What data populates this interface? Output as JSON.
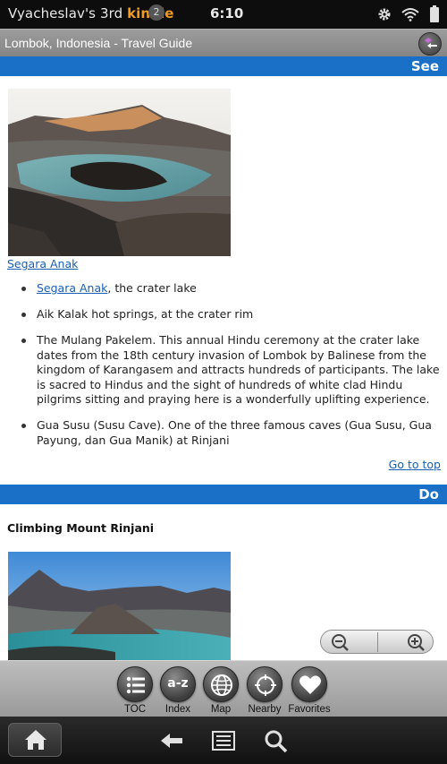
{
  "status_bar": {
    "device_name": "Vyacheslav's 3rd ",
    "device_brand": "kindle",
    "notification_count": "2",
    "time": "6:10"
  },
  "title_bar": {
    "title": "Lombok, Indonesia - Travel Guide"
  },
  "sections": {
    "see": {
      "header": "See"
    },
    "do": {
      "header": "Do"
    }
  },
  "see": {
    "image_caption": "Segara Anak",
    "items": [
      {
        "link": "Segara Anak",
        "text": ", the crater lake"
      },
      {
        "text": "Aik Kalak hot springs, at the crater rim"
      },
      {
        "text": "The Mulang Pakelem. This annual Hindu ceremony at the crater lake dates from the 18th century invasion of Lombok by Balinese from the kingdom of Karangasem and attracts hundreds of participants. The lake is sacred to Hindus and the sight of hundreds of white clad Hindu pilgrims sitting and praying here is a wonderfully uplifting experience."
      },
      {
        "text": "Gua Susu (Susu Cave). One of the three famous caves (Gua Susu, Gua Payung, dan Gua Manik) at Rinjani"
      }
    ],
    "goto_top": "Go to top"
  },
  "do": {
    "subheading": "Climbing Mount Rinjani"
  },
  "toolbar": {
    "toc": "TOC",
    "index": "Index",
    "index_glyph": "a-z",
    "map": "Map",
    "nearby": "Nearby",
    "favorites": "Favorites"
  },
  "icons": {
    "settings": "gear-icon",
    "wifi": "wifi-icon",
    "battery": "battery-icon",
    "back": "back-arrow-icon",
    "home": "home-icon",
    "menu": "menu-icon",
    "search": "search-icon"
  },
  "colors": {
    "section_header": "#1a6fc7",
    "link": "#1a5fb4",
    "brand": "#f39a1e",
    "title_bar": "#8f8f8f"
  }
}
